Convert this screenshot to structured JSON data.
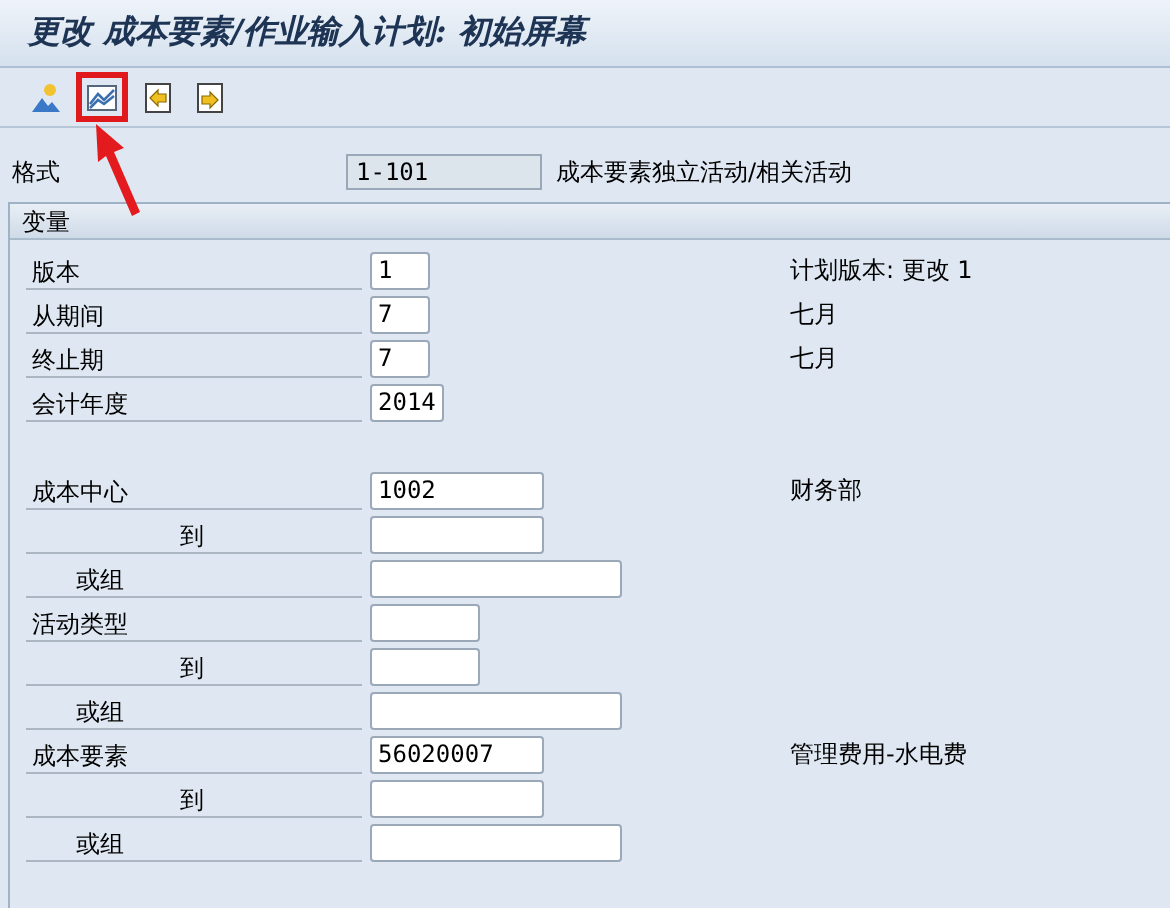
{
  "window": {
    "title": "更改 成本要素/作业输入计划: 初始屏幕"
  },
  "toolbar": [
    {
      "kind": "person",
      "highlighted": false
    },
    {
      "kind": "chart",
      "highlighted": true
    },
    {
      "kind": "back",
      "highlighted": false
    },
    {
      "kind": "forward",
      "highlighted": false
    }
  ],
  "format": {
    "label": "格式",
    "value": "1-101",
    "description": "成本要素独立活动/相关活动"
  },
  "group": {
    "title": "变量",
    "blocks": [
      [
        {
          "kind": "field",
          "label": "版本",
          "input": {
            "kind": "short",
            "value": "1"
          },
          "description": "计划版本: 更改 1"
        },
        {
          "kind": "field",
          "label": "从期间",
          "input": {
            "kind": "short",
            "value": "7"
          },
          "description": "七月"
        },
        {
          "kind": "field",
          "label": "终止期",
          "input": {
            "kind": "short",
            "value": "7"
          },
          "description": "七月"
        },
        {
          "kind": "field",
          "label": "会计年度",
          "input": {
            "kind": "year",
            "value": "2014"
          }
        }
      ],
      [
        {
          "kind": "field",
          "label": "成本中心",
          "input": {
            "kind": "medium",
            "value": "1002"
          },
          "description": "财务部"
        },
        {
          "kind": "to",
          "label": "到",
          "input": {
            "kind": "medium"
          }
        },
        {
          "kind": "or",
          "label": "或组",
          "input": {
            "kind": "long"
          }
        },
        {
          "kind": "field",
          "label": "活动类型",
          "input": {
            "kind": "small"
          }
        },
        {
          "kind": "to",
          "label": "到",
          "input": {
            "kind": "small"
          }
        },
        {
          "kind": "or",
          "label": "或组",
          "input": {
            "kind": "long"
          }
        },
        {
          "kind": "field",
          "label": "成本要素",
          "input": {
            "kind": "medium",
            "value": "56020007"
          },
          "description": "管理费用-水电费"
        },
        {
          "kind": "to",
          "label": "到",
          "input": {
            "kind": "medium"
          }
        },
        {
          "kind": "or",
          "label": "或组",
          "input": {
            "kind": "long"
          }
        }
      ]
    ]
  }
}
